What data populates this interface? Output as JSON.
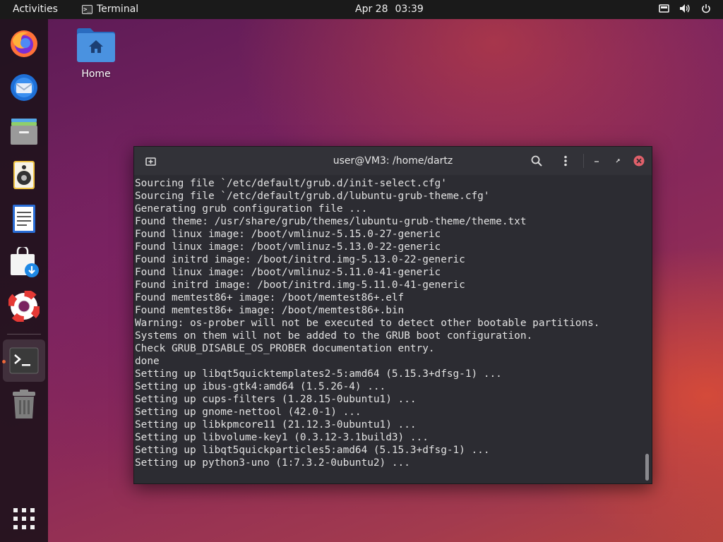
{
  "topbar": {
    "activities": "Activities",
    "app_name": "Terminal",
    "date": "Apr 28",
    "time": "03:39"
  },
  "dock": {
    "items": [
      {
        "name": "Firefox",
        "icon": "firefox-icon"
      },
      {
        "name": "Thunderbird",
        "icon": "thunderbird-icon"
      },
      {
        "name": "Files",
        "icon": "files-icon"
      },
      {
        "name": "Rhythmbox",
        "icon": "speaker-icon"
      },
      {
        "name": "LibreOffice Writer",
        "icon": "document-icon"
      },
      {
        "name": "Ubuntu Software",
        "icon": "software-bag-icon"
      },
      {
        "name": "Help",
        "icon": "lifebuoy-icon"
      },
      {
        "name": "Terminal",
        "icon": "terminal-icon",
        "active": true
      },
      {
        "name": "Trash",
        "icon": "trash-icon"
      },
      {
        "name": "Show Applications",
        "icon": "app-grid-icon"
      }
    ]
  },
  "desktop": {
    "home_label": "Home"
  },
  "terminal": {
    "title": "user@VM3: /home/dartz",
    "lines": [
      "Sourcing file `/etc/default/grub.d/init-select.cfg'",
      "Sourcing file `/etc/default/grub.d/lubuntu-grub-theme.cfg'",
      "Generating grub configuration file ...",
      "Found theme: /usr/share/grub/themes/lubuntu-grub-theme/theme.txt",
      "Found linux image: /boot/vmlinuz-5.15.0-27-generic",
      "Found linux image: /boot/vmlinuz-5.13.0-22-generic",
      "Found initrd image: /boot/initrd.img-5.13.0-22-generic",
      "Found linux image: /boot/vmlinuz-5.11.0-41-generic",
      "Found initrd image: /boot/initrd.img-5.11.0-41-generic",
      "Found memtest86+ image: /boot/memtest86+.elf",
      "Found memtest86+ image: /boot/memtest86+.bin",
      "Warning: os-prober will not be executed to detect other bootable partitions.",
      "Systems on them will not be added to the GRUB boot configuration.",
      "Check GRUB_DISABLE_OS_PROBER documentation entry.",
      "done",
      "Setting up libqt5quicktemplates2-5:amd64 (5.15.3+dfsg-1) ...",
      "Setting up ibus-gtk4:amd64 (1.5.26-4) ...",
      "Setting up cups-filters (1.28.15-0ubuntu1) ...",
      "Setting up gnome-nettool (42.0-1) ...",
      "Setting up libkpmcore11 (21.12.3-0ubuntu1) ...",
      "Setting up libvolume-key1 (0.3.12-3.1build3) ...",
      "Setting up libqt5quickparticles5:amd64 (5.15.3+dfsg-1) ...",
      "Setting up python3-uno (1:7.3.2-0ubuntu2) ..."
    ]
  },
  "colors": {
    "accent": "#e95420",
    "terminal_bg": "#2c2c32",
    "close_button": "#e0606a"
  }
}
